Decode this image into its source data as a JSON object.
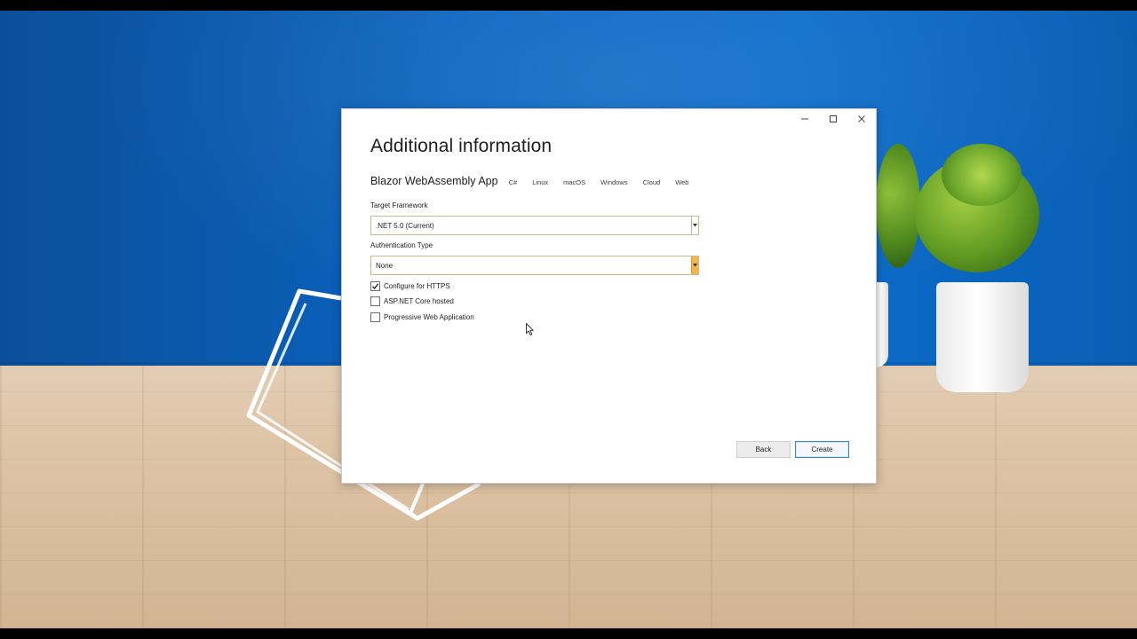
{
  "dialog": {
    "title": "Additional information",
    "template_name": "Blazor WebAssembly App",
    "tags": [
      "C#",
      "Linux",
      "macOS",
      "Windows",
      "Cloud",
      "Web"
    ],
    "target_framework": {
      "label": "Target Framework",
      "value": ".NET 5.0 (Current)"
    },
    "authentication": {
      "label": "Authentication Type",
      "value": "None"
    },
    "options": [
      {
        "label": "Configure for HTTPS",
        "checked": true
      },
      {
        "label": "ASP.NET Core hosted",
        "checked": false
      },
      {
        "label": "Progressive Web Application",
        "checked": false
      }
    ],
    "buttons": {
      "back": "Back",
      "create": "Create"
    }
  },
  "icons": {
    "minimize": "minimize-icon",
    "maximize": "maximize-icon",
    "close": "close-icon",
    "dropdown": "chevron-down-icon",
    "check": "checkmark-icon",
    "cursor": "mouse-pointer-icon"
  },
  "colors": {
    "wall": "#0a64c0",
    "floor": "#dcc2a3",
    "dropdown_accent": "#f3b64a",
    "create_border": "#3a86d4"
  }
}
